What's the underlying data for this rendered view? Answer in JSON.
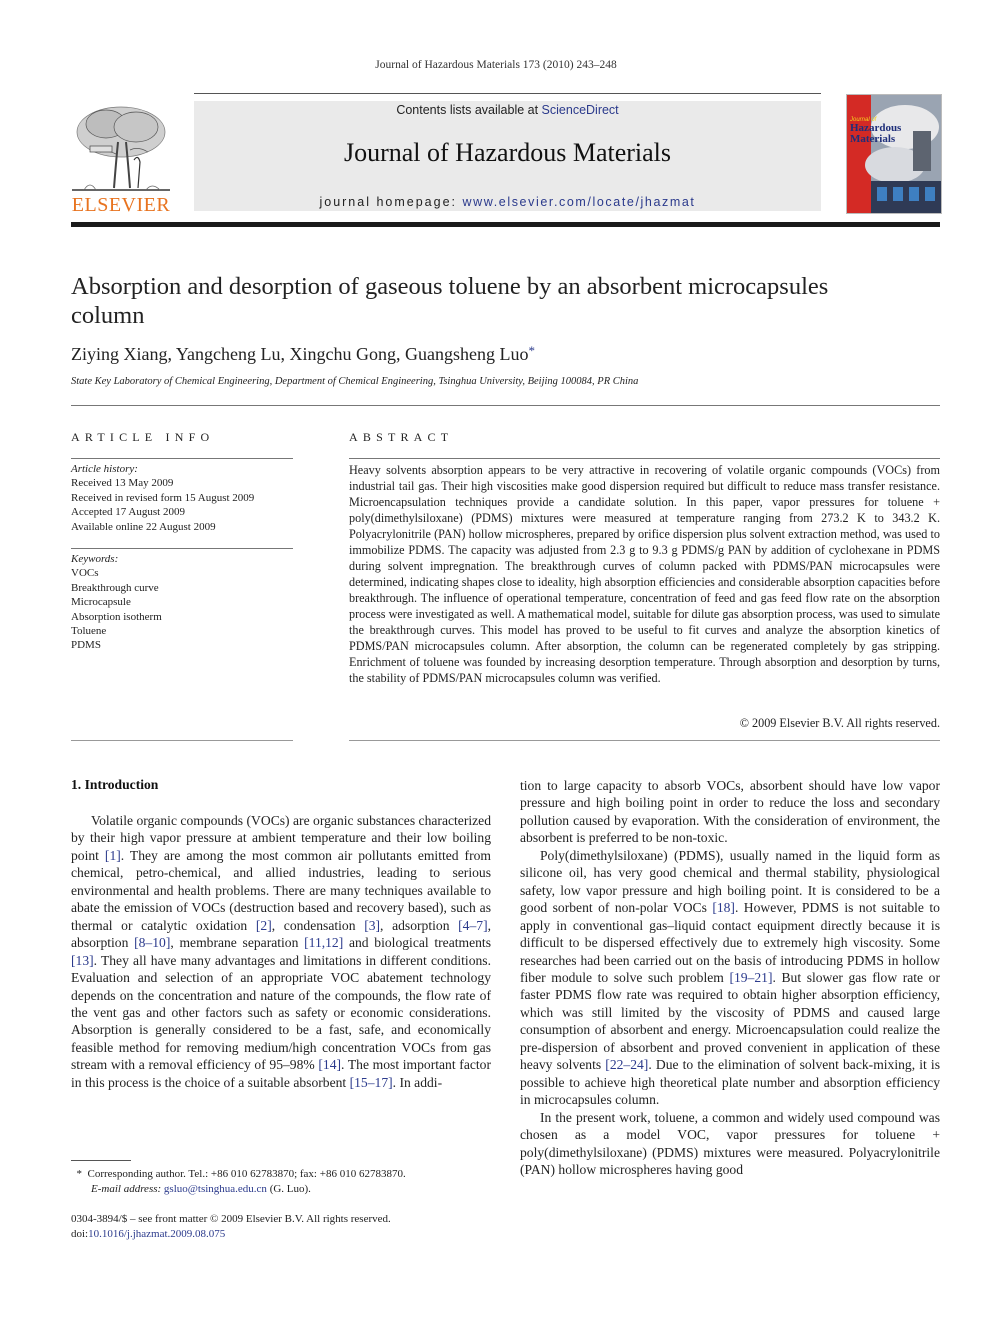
{
  "running_header": "Journal of Hazardous Materials 173 (2010) 243–248",
  "masthead": {
    "publisher_logo_text": "ELSEVIER",
    "contents_prefix": "Contents lists available at ",
    "contents_link": "ScienceDirect",
    "journal_title": "Journal of Hazardous Materials",
    "homepage_prefix": "journal homepage: ",
    "homepage_url": "www.elsevier.com/locate/jhazmat",
    "cover_title_line1": "Journal of",
    "cover_title_line2": "Hazardous",
    "cover_title_line3": "Materials",
    "colors": {
      "elsevier_orange": "#e8731f",
      "link_blue": "#2b3a8c",
      "cover_red": "#d42a25",
      "banner_gray": "#eaeaea"
    }
  },
  "article": {
    "title": "Absorption and desorption of gaseous toluene by an absorbent microcapsules column",
    "authors": "Ziying Xiang, Yangcheng Lu, Xingchu Gong, Guangsheng Luo",
    "corresponding_marker": "*",
    "affiliation": "State Key Laboratory of Chemical Engineering, Department of Chemical Engineering, Tsinghua University, Beijing 100084, PR China"
  },
  "article_info": {
    "heading": "ARTICLE INFO",
    "history_label": "Article history:",
    "history": [
      "Received 13 May 2009",
      "Received in revised form 15 August 2009",
      "Accepted 17 August 2009",
      "Available online 22 August 2009"
    ],
    "keywords_label": "Keywords:",
    "keywords": [
      "VOCs",
      "Breakthrough curve",
      "Microcapsule",
      "Absorption isotherm",
      "Toluene",
      "PDMS"
    ]
  },
  "abstract": {
    "heading": "ABSTRACT",
    "text": "Heavy solvents absorption appears to be very attractive in recovering of volatile organic compounds (VOCs) from industrial tail gas. Their high viscosities make good dispersion required but difficult to reduce mass transfer resistance. Microencapsulation techniques provide a candidate solution. In this paper, vapor pressures for toluene + poly(dimethylsiloxane) (PDMS) mixtures were measured at temperature ranging from 273.2 K to 343.2 K. Polyacrylonitrile (PAN) hollow microspheres, prepared by orifice dispersion plus solvent extraction method, was used to immobilize PDMS. The capacity was adjusted from 2.3 g to 9.3 g PDMS/g PAN by addition of cyclohexane in PDMS during solvent impregnation. The breakthrough curves of column packed with PDMS/PAN microcapsules were determined, indicating shapes close to ideality, high absorption efficiencies and considerable absorption capacities before breakthrough. The influence of operational temperature, concentration of feed and gas feed flow rate on the absorption process were investigated as well. A mathematical model, suitable for dilute gas absorption process, was used to simulate the breakthrough curves. This model has proved to be useful to fit curves and analyze the absorption kinetics of PDMS/PAN microcapsules column. After absorption, the column can be regenerated completely by gas stripping. Enrichment of toluene was founded by increasing desorption temperature. Through absorption and desorption by turns, the stability of PDMS/PAN microcapsules column was verified.",
    "copyright": "© 2009 Elsevier B.V. All rights reserved."
  },
  "introduction": {
    "heading": "1.  Introduction",
    "p1": [
      {
        "t": "Volatile organic compounds (VOCs) are organic substances characterized by their high vapor pressure at ambient temperature and their low boiling point "
      },
      {
        "ref": "[1]"
      },
      {
        "t": ". They are among the most common air pollutants emitted from chemical, petro-chemical, and allied industries, leading to serious environmental and health problems. There are many techniques available to abate the emission of VOCs (destruction based and recovery based), such as thermal or catalytic oxidation "
      },
      {
        "ref": "[2]"
      },
      {
        "t": ", condensation "
      },
      {
        "ref": "[3]"
      },
      {
        "t": ", adsorption "
      },
      {
        "ref": "[4–7]"
      },
      {
        "t": ", absorption "
      },
      {
        "ref": "[8–10]"
      },
      {
        "t": ", membrane separation "
      },
      {
        "ref": "[11,12]"
      },
      {
        "t": " and biological treatments "
      },
      {
        "ref": "[13]"
      },
      {
        "t": ". They all have many advantages and limitations in different conditions. Evaluation and selection of an appropriate VOC abatement technology depends on the concentration and nature of the compounds, the flow rate of the vent gas and other factors such as safety or economic considerations. Absorption is generally considered to be a fast, safe, and economically feasible method for removing medium/high concentration VOCs from gas stream with a removal efficiency of 95–98% "
      },
      {
        "ref": "[14]"
      },
      {
        "t": ". The most important factor in this process is the choice of a suitable absorbent "
      },
      {
        "ref": "[15–17]"
      },
      {
        "t": ". In addi-"
      }
    ],
    "p1_cont": "tion to large capacity to absorb VOCs, absorbent should have low vapor pressure and high boiling point in order to reduce the loss and secondary pollution caused by evaporation. With the consideration of environment, the absorbent is preferred to be non-toxic.",
    "p2": [
      {
        "t": "Poly(dimethylsiloxane) (PDMS), usually named in the liquid form as silicone oil, has very good chemical and thermal stability, physiological safety, low vapor pressure and high boiling point. It is considered to be a good sorbent of non-polar VOCs "
      },
      {
        "ref": "[18]"
      },
      {
        "t": ". However, PDMS is not suitable to apply in conventional gas–liquid contact equipment directly because it is difficult to be dispersed effectively due to extremely high viscosity. Some researches had been carried out on the basis of introducing PDMS in hollow fiber module to solve such problem "
      },
      {
        "ref": "[19–21]"
      },
      {
        "t": ". But slower gas flow rate or faster PDMS flow rate was required to obtain higher absorption efficiency, which was still limited by the viscosity of PDMS and caused large consumption of absorbent and energy. Microencapsulation could realize the pre-dispersion of absorbent and proved convenient in application of these heavy solvents "
      },
      {
        "ref": "[22–24]"
      },
      {
        "t": ". Due to the elimination of solvent back-mixing, it is possible to achieve high theoretical plate number and absorption efficiency in microcapsules column."
      }
    ],
    "p3": "In the present work, toluene, a common and widely used compound was chosen as a model VOC, vapor pressures for toluene + poly(dimethylsiloxane) (PDMS) mixtures were measured. Polyacrylonitrile (PAN) hollow microspheres having good"
  },
  "footnote": {
    "marker": "*",
    "corresponding": "Corresponding author. Tel.: +86 010 62783870; fax: +86 010 62783870.",
    "email_label": "E-mail address:",
    "email": "gsluo@tsinghua.edu.cn",
    "email_suffix": " (G. Luo)."
  },
  "front_matter": {
    "issn_line": "0304-3894/$ – see front matter © 2009 Elsevier B.V. All rights reserved.",
    "doi_prefix": "doi:",
    "doi": "10.1016/j.jhazmat.2009.08.075"
  }
}
